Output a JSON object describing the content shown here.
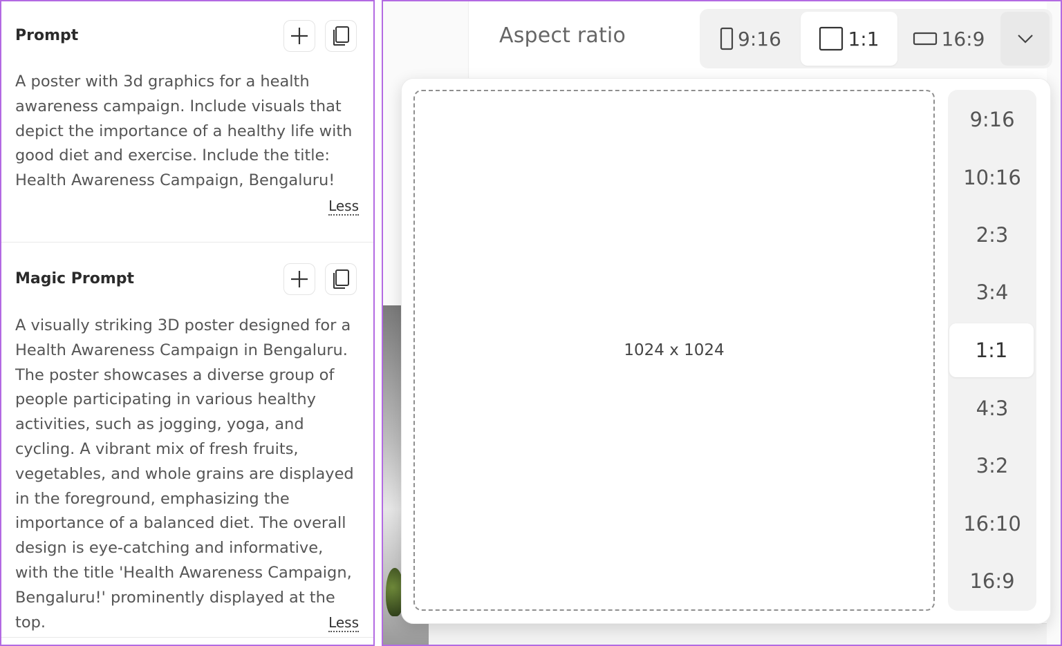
{
  "prompt_section": {
    "title": "Prompt",
    "text": "A poster with 3d graphics for a health awareness campaign. Include visuals that depict the importance of a healthy life with good diet and exercise. Include the title: Health Awareness Campaign, Bengaluru!",
    "less_label": "Less",
    "add_icon": "plus-icon",
    "copy_icon": "copy-icon"
  },
  "magic_prompt_section": {
    "title": "Magic Prompt",
    "text": "A visually striking 3D poster designed for a Health Awareness Campaign in Bengaluru. The poster showcases a diverse group of people participating in various healthy activities, such as jogging, yoga, and cycling. A vibrant mix of fresh fruits, vegetables, and whole grains are displayed in the foreground, emphasizing the importance of a balanced diet. The overall design is eye-catching and informative, with the title 'Health Awareness Campaign, Bengaluru!' prominently displayed at the top.",
    "less_label": "Less",
    "add_icon": "plus-icon",
    "copy_icon": "copy-icon"
  },
  "aspect_ratio": {
    "label": "Aspect ratio",
    "quick_options": [
      {
        "label": "9:16",
        "icon": "portrait-rect-icon",
        "active": false
      },
      {
        "label": "1:1",
        "icon": "square-icon",
        "active": true
      },
      {
        "label": "16:9",
        "icon": "landscape-rect-icon",
        "active": false
      }
    ],
    "dropdown_icon": "chevron-down-icon",
    "preview_size": "1024 x 1024",
    "ratio_list": [
      "9:16",
      "10:16",
      "2:3",
      "3:4",
      "1:1",
      "4:3",
      "3:2",
      "16:10",
      "16:9"
    ],
    "selected_ratio": "1:1"
  },
  "colors": {
    "accent_border": "#b36ae2",
    "panel_bg": "#f1f1f1"
  }
}
